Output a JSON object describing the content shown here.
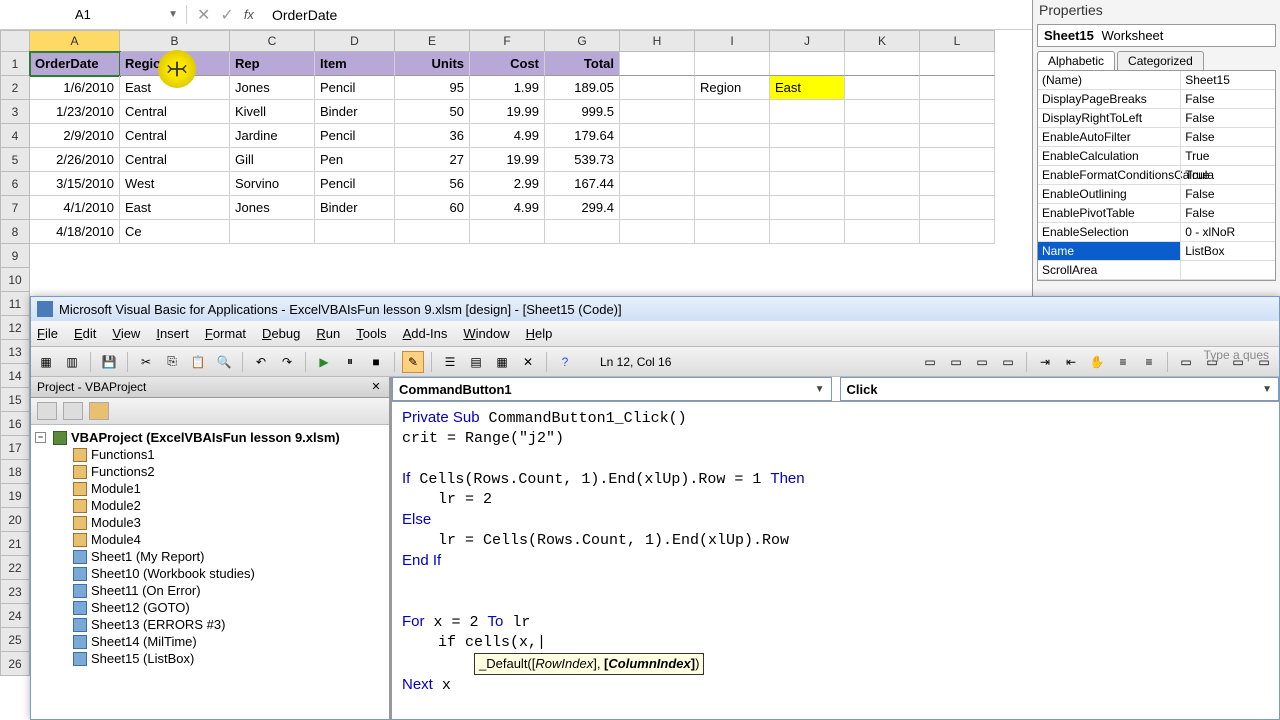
{
  "namebox": {
    "ref": "A1",
    "fx": "fx",
    "formula": "OrderDate"
  },
  "columns": [
    "A",
    "B",
    "C",
    "D",
    "E",
    "F",
    "G",
    "H",
    "I",
    "J",
    "K",
    "L"
  ],
  "headers": [
    "OrderDate",
    "Region",
    "Rep",
    "Item",
    "Units",
    "Cost",
    "Total"
  ],
  "rows": [
    [
      "1/6/2010",
      "East",
      "Jones",
      "Pencil",
      "95",
      "1.99",
      "189.05"
    ],
    [
      "1/23/2010",
      "Central",
      "Kivell",
      "Binder",
      "50",
      "19.99",
      "999.5"
    ],
    [
      "2/9/2010",
      "Central",
      "Jardine",
      "Pencil",
      "36",
      "4.99",
      "179.64"
    ],
    [
      "2/26/2010",
      "Central",
      "Gill",
      "Pen",
      "27",
      "19.99",
      "539.73"
    ],
    [
      "3/15/2010",
      "West",
      "Sorvino",
      "Pencil",
      "56",
      "2.99",
      "167.44"
    ],
    [
      "4/1/2010",
      "East",
      "Jones",
      "Binder",
      "60",
      "4.99",
      "299.4"
    ],
    [
      "4/18/2010",
      "Ce",
      "",
      "",
      "",
      "",
      ""
    ]
  ],
  "side": {
    "i2": "Region",
    "j2": "East"
  },
  "rownums_extra": [
    "9",
    "10",
    "11",
    "12",
    "13",
    "14",
    "15",
    "16",
    "17",
    "18",
    "19",
    "20",
    "21",
    "22",
    "23",
    "24",
    "25",
    "26"
  ],
  "props": {
    "panel_title": "Properties",
    "obj_name": "Sheet15",
    "obj_type": "Worksheet",
    "tabs": [
      "Alphabetic",
      "Categorized"
    ],
    "items": [
      {
        "k": "(Name)",
        "v": "Sheet15"
      },
      {
        "k": "DisplayPageBreaks",
        "v": "False"
      },
      {
        "k": "DisplayRightToLeft",
        "v": "False"
      },
      {
        "k": "EnableAutoFilter",
        "v": "False"
      },
      {
        "k": "EnableCalculation",
        "v": "True"
      },
      {
        "k": "EnableFormatConditionsCalcula",
        "v": "True"
      },
      {
        "k": "EnableOutlining",
        "v": "False"
      },
      {
        "k": "EnablePivotTable",
        "v": "False"
      },
      {
        "k": "EnableSelection",
        "v": "0 - xlNoR"
      },
      {
        "k": "Name",
        "v": "ListBox",
        "sel": true
      },
      {
        "k": "ScrollArea",
        "v": ""
      }
    ]
  },
  "vbe": {
    "title": "Microsoft Visual Basic for Applications - ExcelVBAIsFun lesson 9.xlsm [design] - [Sheet15 (Code)]",
    "menus": [
      "File",
      "Edit",
      "View",
      "Insert",
      "Format",
      "Debug",
      "Run",
      "Tools",
      "Add-Ins",
      "Window",
      "Help"
    ],
    "question": "Type a ques",
    "cursor_pos": "Ln 12, Col 16",
    "proj_title": "Project - VBAProject",
    "tree_root": "VBAProject (ExcelVBAIsFun lesson 9.xlsm)",
    "tree": [
      {
        "t": "Functions1",
        "ico": "m"
      },
      {
        "t": "Functions2",
        "ico": "m"
      },
      {
        "t": "Module1",
        "ico": "m"
      },
      {
        "t": "Module2",
        "ico": "m"
      },
      {
        "t": "Module3",
        "ico": "m"
      },
      {
        "t": "Module4",
        "ico": "m"
      },
      {
        "t": "Sheet1 (My Report)",
        "ico": "s"
      },
      {
        "t": "Sheet10 (Workbook studies)",
        "ico": "s"
      },
      {
        "t": "Sheet11 (On Error)",
        "ico": "s"
      },
      {
        "t": "Sheet12 (GOTO)",
        "ico": "s"
      },
      {
        "t": "Sheet13 (ERRORS #3)",
        "ico": "s"
      },
      {
        "t": "Sheet14 (MilTime)",
        "ico": "s"
      },
      {
        "t": "Sheet15 (ListBox)",
        "ico": "s"
      }
    ],
    "dd_left": "CommandButton1",
    "dd_right": "Click",
    "code_lines": [
      {
        "pre": "",
        "kw": "Private Sub",
        "post": " CommandButton1_Click()"
      },
      {
        "pre": "crit = Range(\"j2\")",
        "kw": "",
        "post": ""
      },
      {
        "pre": "",
        "kw": "",
        "post": ""
      },
      {
        "pre": "",
        "kw": "If",
        "post": " Cells(Rows.Count, 1).End(xlUp).Row = 1 ",
        "kw2": "Then"
      },
      {
        "pre": "    lr = 2",
        "kw": "",
        "post": ""
      },
      {
        "pre": "",
        "kw": "Else",
        "post": ""
      },
      {
        "pre": "    lr = Cells(Rows.Count, 1).End(xlUp).Row",
        "kw": "",
        "post": ""
      },
      {
        "pre": "",
        "kw": "End If",
        "post": ""
      },
      {
        "pre": "",
        "kw": "",
        "post": ""
      },
      {
        "pre": "",
        "kw": "",
        "post": ""
      },
      {
        "pre": "",
        "kw": "For",
        "post": " x = 2 ",
        "kw2": "To",
        "post2": " lr"
      },
      {
        "pre": "    if cells(x,",
        "kw": "",
        "post": "",
        "cursor": true
      },
      {
        "tooltip": true,
        "pre": "        ",
        "text": "_Default([RowIndex], [ColumnIndex])",
        "bold": "ColumnIndex"
      },
      {
        "pre": "",
        "kw": "Next",
        "post": " x"
      }
    ]
  }
}
